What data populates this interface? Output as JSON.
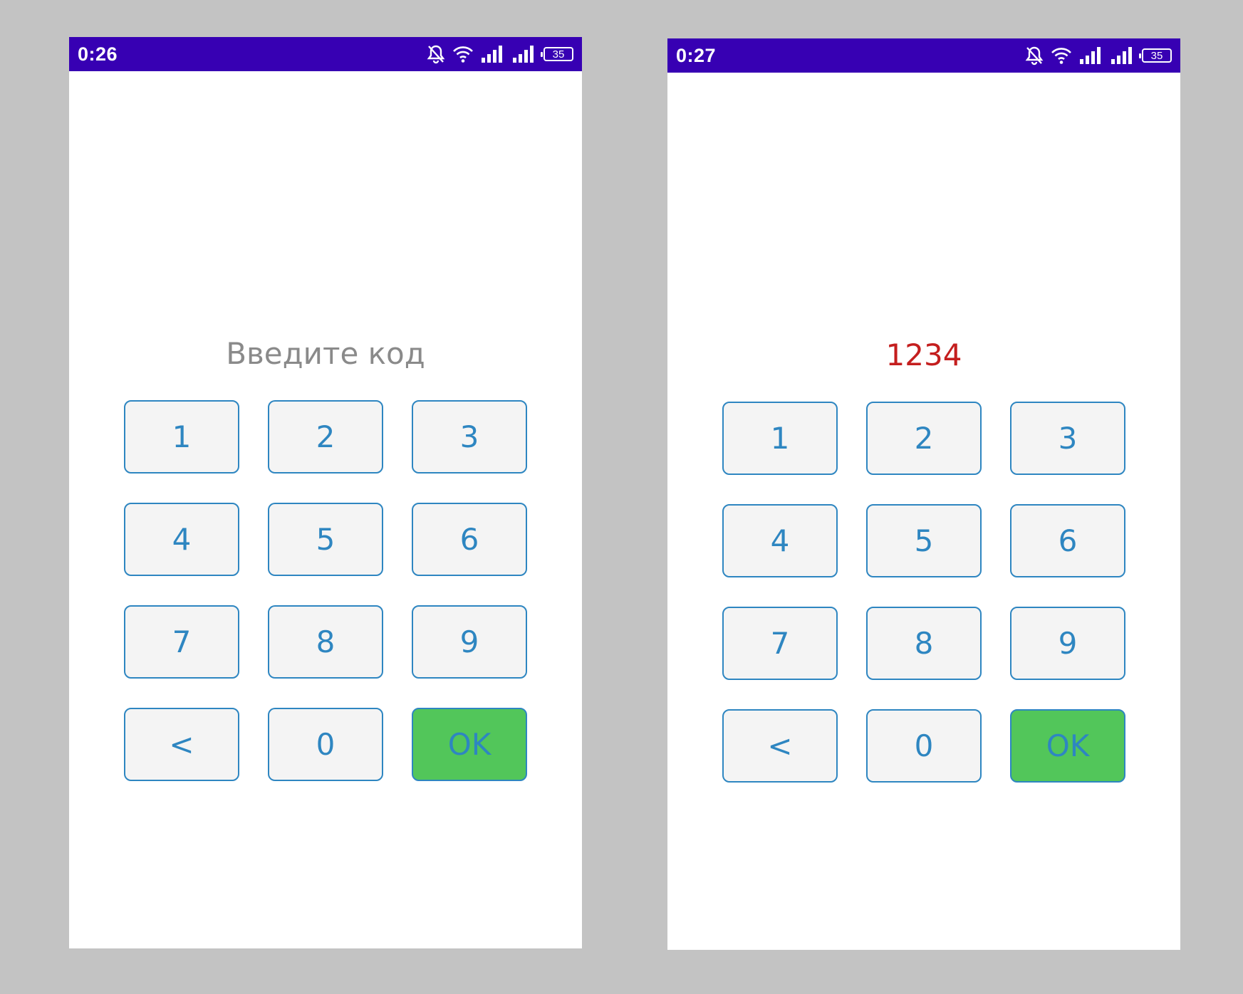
{
  "screens": [
    {
      "status_time": "0:26",
      "battery": "35",
      "display_text": "Введите код",
      "keys": [
        "1",
        "2",
        "3",
        "4",
        "5",
        "6",
        "7",
        "8",
        "9",
        "<",
        "0",
        "OK"
      ]
    },
    {
      "status_time": "0:27",
      "battery": "35",
      "display_text": "1234",
      "keys": [
        "1",
        "2",
        "3",
        "4",
        "5",
        "6",
        "7",
        "8",
        "9",
        "<",
        "0",
        "OK"
      ]
    }
  ],
  "colors": {
    "page_background": "#c3c3c3",
    "status_bar": "#3700b3",
    "key_border": "#2e86c1",
    "key_text": "#2e86c1",
    "key_background": "#f4f4f4",
    "ok_background": "#52c65a",
    "prompt_text": "#8a8a8a",
    "code_text": "#c41e1e"
  },
  "icons": {
    "status": [
      "bell-off-icon",
      "wifi-icon",
      "signal-icon-sim1",
      "signal-icon-sim2",
      "battery-icon"
    ],
    "key_names": [
      "key-1-button",
      "key-2-button",
      "key-3-button",
      "key-4-button",
      "key-5-button",
      "key-6-button",
      "key-7-button",
      "key-8-button",
      "key-9-button",
      "backspace-button",
      "key-0-button",
      "ok-button"
    ]
  }
}
